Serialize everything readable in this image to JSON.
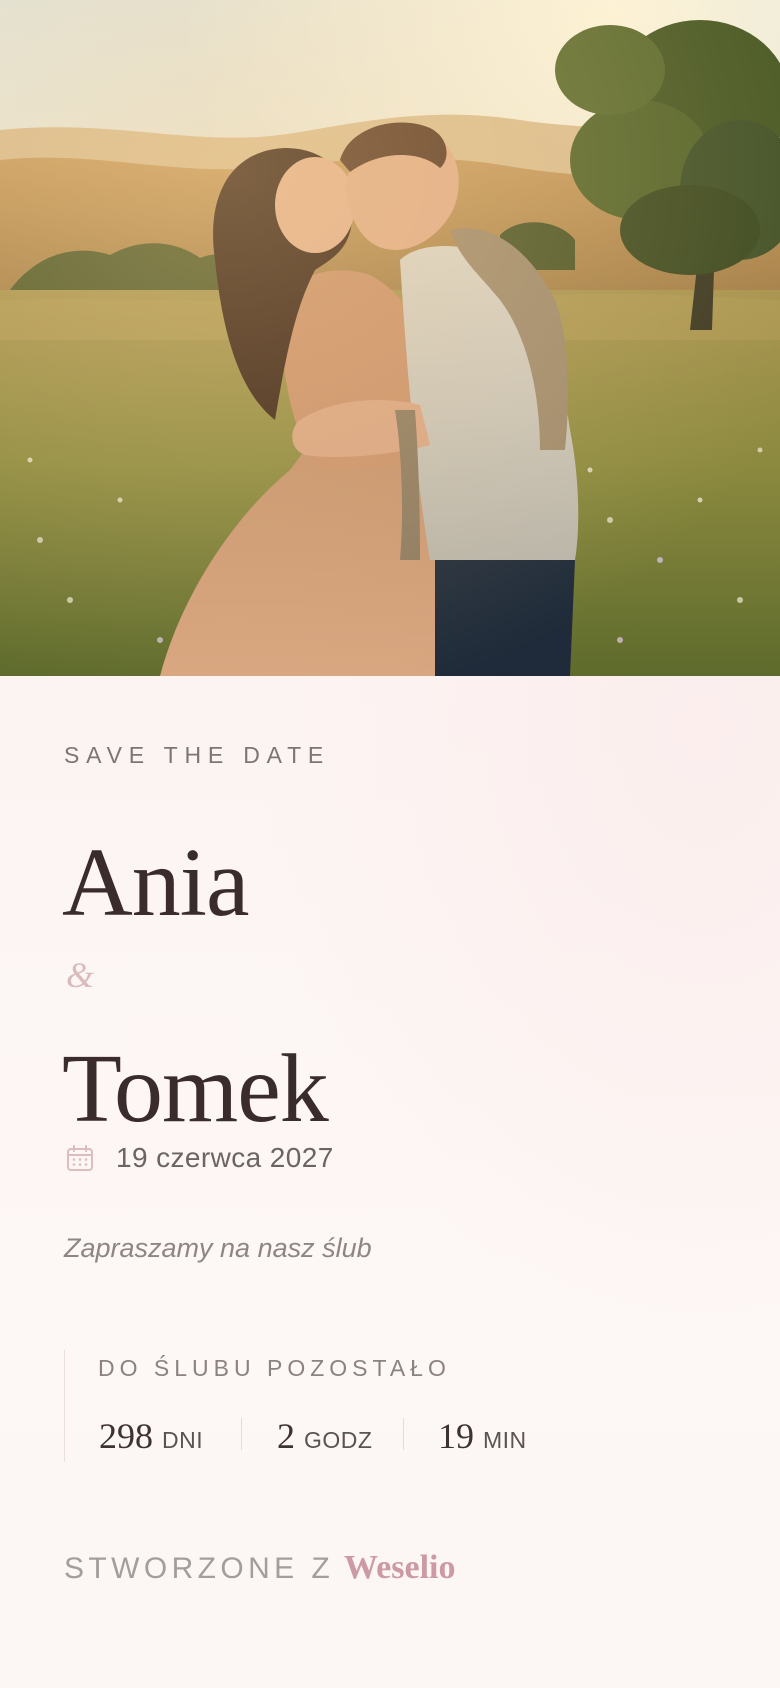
{
  "hero": {
    "image_description": "engaged-couple-embracing-in-meadow-at-sunset"
  },
  "invite": {
    "eyebrow": "SAVE THE DATE",
    "partner_one": "Ania",
    "ampersand": "&",
    "partner_two": "Tomek",
    "date_icon": "calendar-icon",
    "date": "19 czerwca 2027",
    "tagline": "Zapraszamy na nasz ślub"
  },
  "countdown": {
    "label": "DO ŚLUBU POZOSTAŁO",
    "days_value": "298",
    "days_unit": "DNI",
    "hours_value": "2",
    "hours_unit": "GODZ",
    "minutes_value": "19",
    "minutes_unit": "MIN"
  },
  "footer": {
    "prefix": "STWORZONE Z",
    "brand": "Weselio"
  },
  "colors": {
    "background": "#fcf6f4",
    "heading": "#3a2c2c",
    "muted": "#7d7574",
    "accent": "#cc9aa2"
  }
}
